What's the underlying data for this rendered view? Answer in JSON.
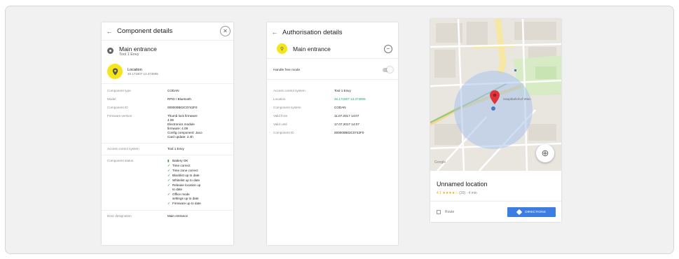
{
  "panel1": {
    "title": "Component details",
    "subtitle_title": "Main entrance",
    "subtitle_sub": "Tool 1 Envy",
    "location_title": "Location",
    "location_sub": "46.171907 13.373905",
    "rows": [
      {
        "key": "Component type",
        "value": "CODAN"
      },
      {
        "key": "Model",
        "value": "RFID / Bluetooth"
      },
      {
        "key": "Component ID",
        "value": "000000B02C0742F0"
      },
      {
        "key": "Firmware version",
        "value": "Thumb lock firmware\n4.06\nElectronics module\nfirmware: 4.09\nConfig component: Jaco\nCard update: 2.4h"
      },
      {
        "key": "Access control system",
        "value": "Tool 1 Envy"
      }
    ],
    "status_key": "Component status",
    "battery_label": "Battery OK",
    "status_checks": [
      "Time correct",
      "Time zone correct",
      "Blacklist up to date",
      "Whitelist up to date",
      "Release location up\nto date",
      "Office mode\nsettings up to date",
      "Firmware up to date"
    ],
    "last_row": {
      "key": "Door designation",
      "value": "Main entrance"
    }
  },
  "panel2": {
    "title": "Authorisation details",
    "subtitle_title": "Main entrance",
    "toggle_label": "Handle free mode",
    "rows": [
      {
        "key": "Access control system",
        "value": "Tool 1 Envy"
      },
      {
        "key": "Location",
        "value": "46.171907 13.373905",
        "highlight": true
      },
      {
        "key": "Component system",
        "value": "CODAN"
      },
      {
        "key": "Valid from",
        "value": "11.07.2017 14:07"
      },
      {
        "key": "Valid until",
        "value": "17.07.2017 14:07"
      },
      {
        "key": "Component ID",
        "value": "000000B02C0742F0"
      }
    ]
  },
  "panel3": {
    "map_label": "Hauptbahnhof Wien",
    "fab_icon": "crosshair-icon",
    "google_label": "Google",
    "card_title": "Unnamed location",
    "rating": "4.1",
    "stars": "★★★★☆",
    "rating_meta": "(20) · 4 min",
    "action_label": "Route",
    "directions_label": "DIRECTIONS"
  }
}
